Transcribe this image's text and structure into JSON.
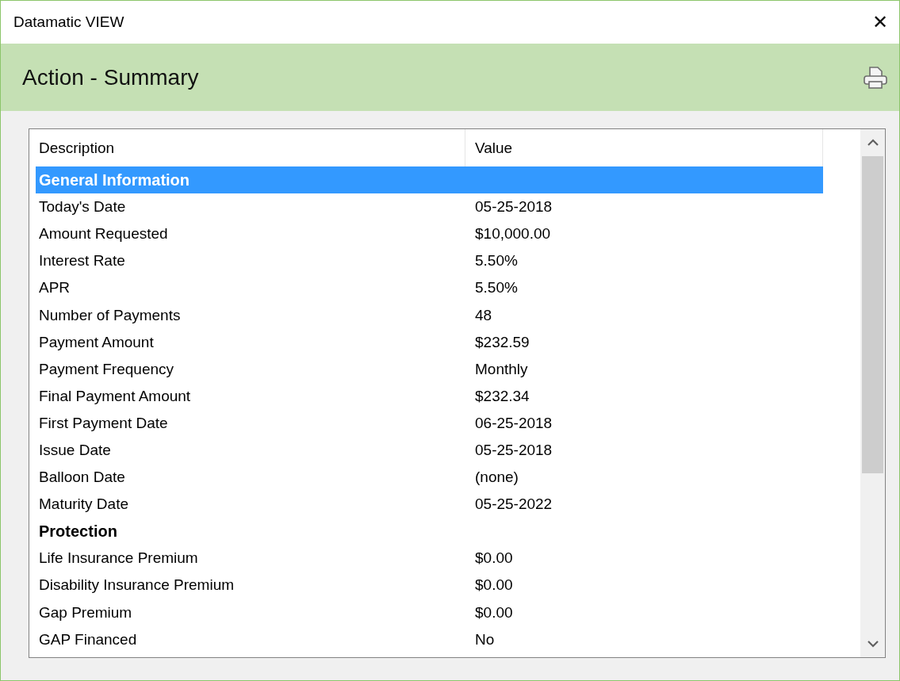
{
  "window": {
    "title": "Datamatic VIEW",
    "close": "✕"
  },
  "header": {
    "title": "Action - Summary"
  },
  "table": {
    "columns": [
      "Description",
      "Value"
    ],
    "rows": [
      {
        "kind": "section",
        "selected": true,
        "description": "General Information"
      },
      {
        "kind": "item",
        "selected": false,
        "description": "Today's Date",
        "value": "05-25-2018"
      },
      {
        "kind": "item",
        "selected": false,
        "description": "Amount Requested",
        "value": "$10,000.00"
      },
      {
        "kind": "item",
        "selected": false,
        "description": "Interest Rate",
        "value": "5.50%"
      },
      {
        "kind": "item",
        "selected": false,
        "description": "APR",
        "value": "5.50%"
      },
      {
        "kind": "item",
        "selected": false,
        "description": "Number of Payments",
        "value": "48"
      },
      {
        "kind": "item",
        "selected": false,
        "description": "Payment Amount",
        "value": "$232.59"
      },
      {
        "kind": "item",
        "selected": false,
        "description": "Payment Frequency",
        "value": "Monthly"
      },
      {
        "kind": "item",
        "selected": false,
        "description": "Final Payment Amount",
        "value": "$232.34"
      },
      {
        "kind": "item",
        "selected": false,
        "description": "First Payment Date",
        "value": "06-25-2018"
      },
      {
        "kind": "item",
        "selected": false,
        "description": "Issue Date",
        "value": "05-25-2018"
      },
      {
        "kind": "item",
        "selected": false,
        "description": "Balloon Date",
        "value": "(none)"
      },
      {
        "kind": "item",
        "selected": false,
        "description": "Maturity Date",
        "value": "05-25-2022"
      },
      {
        "kind": "section",
        "selected": false,
        "description": "Protection"
      },
      {
        "kind": "item",
        "selected": false,
        "description": "Life Insurance Premium",
        "value": "$0.00"
      },
      {
        "kind": "item",
        "selected": false,
        "description": "Disability Insurance Premium",
        "value": "$0.00"
      },
      {
        "kind": "item",
        "selected": false,
        "description": "Gap Premium",
        "value": "$0.00"
      },
      {
        "kind": "item",
        "selected": false,
        "description": "GAP Financed",
        "value": "No"
      }
    ]
  }
}
